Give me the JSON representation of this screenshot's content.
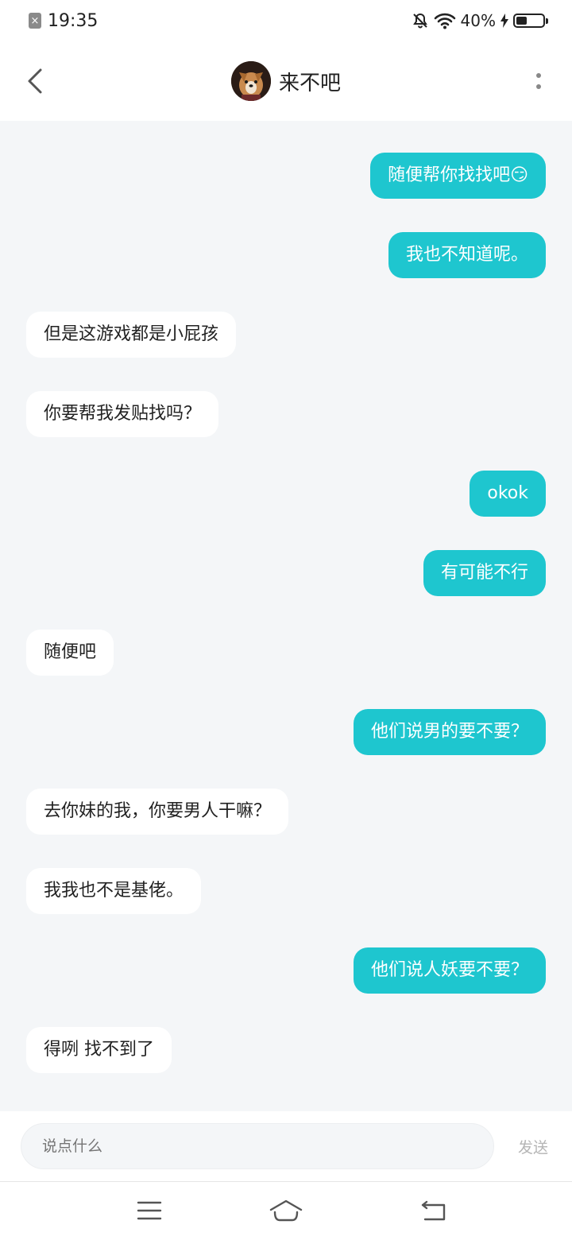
{
  "status_bar": {
    "time": "19:35",
    "battery": "40%",
    "battery_level": 0.4
  },
  "header": {
    "title": "来不吧"
  },
  "messages": [
    {
      "side": "me",
      "text": "随便帮你找找吧😏"
    },
    {
      "side": "me",
      "text": "我也不知道呢。"
    },
    {
      "side": "other",
      "text": "但是这游戏都是小屁孩"
    },
    {
      "side": "other",
      "text": "你要帮我发贴找吗？"
    },
    {
      "side": "me",
      "text": "okok"
    },
    {
      "side": "me",
      "text": "有可能不行"
    },
    {
      "side": "other",
      "text": "随便吧"
    },
    {
      "side": "me",
      "text": "他们说男的要不要？"
    },
    {
      "side": "other",
      "text": "去你妹的我，你要男人干嘛？"
    },
    {
      "side": "other",
      "text": "我我也不是基佬。"
    },
    {
      "side": "me",
      "text": "他们说人妖要不要？"
    },
    {
      "side": "other",
      "text": "得咧 找不到了"
    }
  ],
  "input": {
    "placeholder": "说点什么",
    "send_label": "发送"
  },
  "colors": {
    "my_bubble": "#1ec6cf",
    "other_bubble": "#ffffff",
    "chat_bg": "#f4f6f8"
  },
  "icons": {
    "back": "back-icon",
    "more": "more-icon",
    "nav_menu": "menu-icon",
    "nav_home": "home-icon",
    "nav_back": "nav-back-icon"
  }
}
